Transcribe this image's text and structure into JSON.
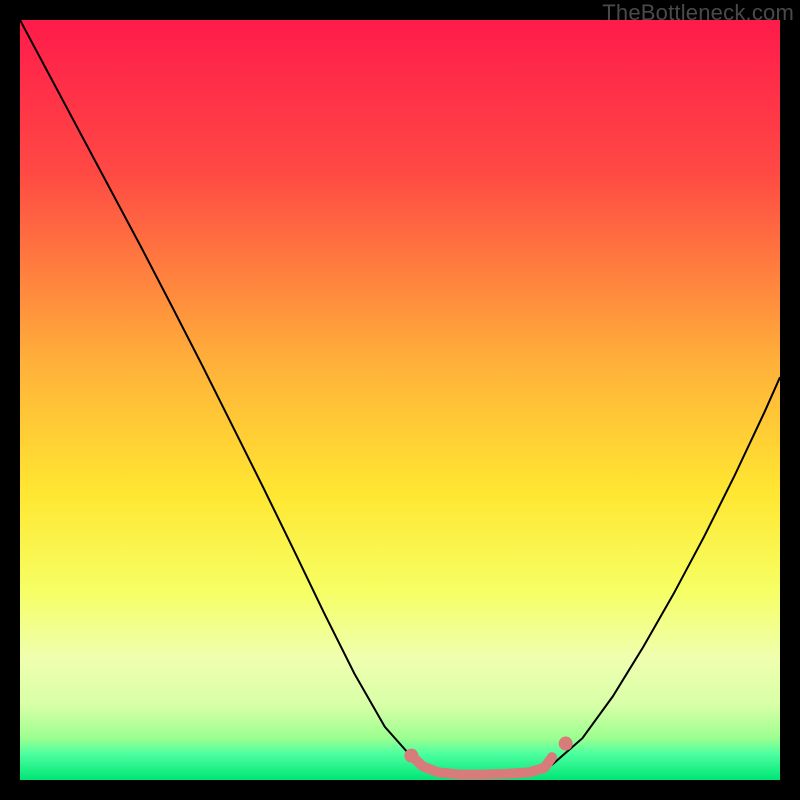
{
  "watermark": "TheBottleneck.com",
  "chart_data": {
    "type": "line",
    "title": "",
    "xlabel": "",
    "ylabel": "",
    "xlim": [
      0,
      100
    ],
    "ylim": [
      0,
      100
    ],
    "gradient_stops": [
      {
        "offset": 0.0,
        "color": "#ff1b4b"
      },
      {
        "offset": 0.2,
        "color": "#ff4944"
      },
      {
        "offset": 0.45,
        "color": "#ffb03a"
      },
      {
        "offset": 0.62,
        "color": "#ffe631"
      },
      {
        "offset": 0.75,
        "color": "#f6ff63"
      },
      {
        "offset": 0.84,
        "color": "#efffb0"
      },
      {
        "offset": 0.9,
        "color": "#d9ffa8"
      },
      {
        "offset": 0.945,
        "color": "#9cff90"
      },
      {
        "offset": 0.965,
        "color": "#4effa0"
      },
      {
        "offset": 1.0,
        "color": "#00e676"
      }
    ],
    "series": [
      {
        "name": "curve",
        "color": "#000000",
        "width": 2,
        "x": [
          0.0,
          4.0,
          8.0,
          12.0,
          16.0,
          20.0,
          24.0,
          28.0,
          32.0,
          36.0,
          40.0,
          44.0,
          48.0,
          52.0,
          55.0,
          58.0,
          61.0,
          64.0,
          67.0,
          70.0,
          74.0,
          78.0,
          82.0,
          86.0,
          90.0,
          94.0,
          98.0,
          100.0
        ],
        "y": [
          100.0,
          92.5,
          85.0,
          77.5,
          70.0,
          62.3,
          54.5,
          46.5,
          38.5,
          30.3,
          22.0,
          14.0,
          7.0,
          2.5,
          1.0,
          0.7,
          0.7,
          0.8,
          1.0,
          2.0,
          5.5,
          11.0,
          17.5,
          24.5,
          32.0,
          40.0,
          48.5,
          53.0
        ]
      },
      {
        "name": "highlight",
        "color": "#d77b7b",
        "width": 10,
        "linecap": "round",
        "x": [
          51.5,
          53.0,
          55.0,
          58.0,
          61.0,
          64.0,
          67.0,
          69.0,
          70.0
        ],
        "y": [
          3.2,
          1.8,
          1.0,
          0.7,
          0.7,
          0.8,
          1.0,
          1.6,
          3.0
        ]
      }
    ],
    "markers": [
      {
        "x": 51.5,
        "y": 3.2,
        "r": 7,
        "color": "#d77b7b"
      },
      {
        "x": 71.8,
        "y": 4.8,
        "r": 7,
        "color": "#d77b7b"
      }
    ]
  }
}
